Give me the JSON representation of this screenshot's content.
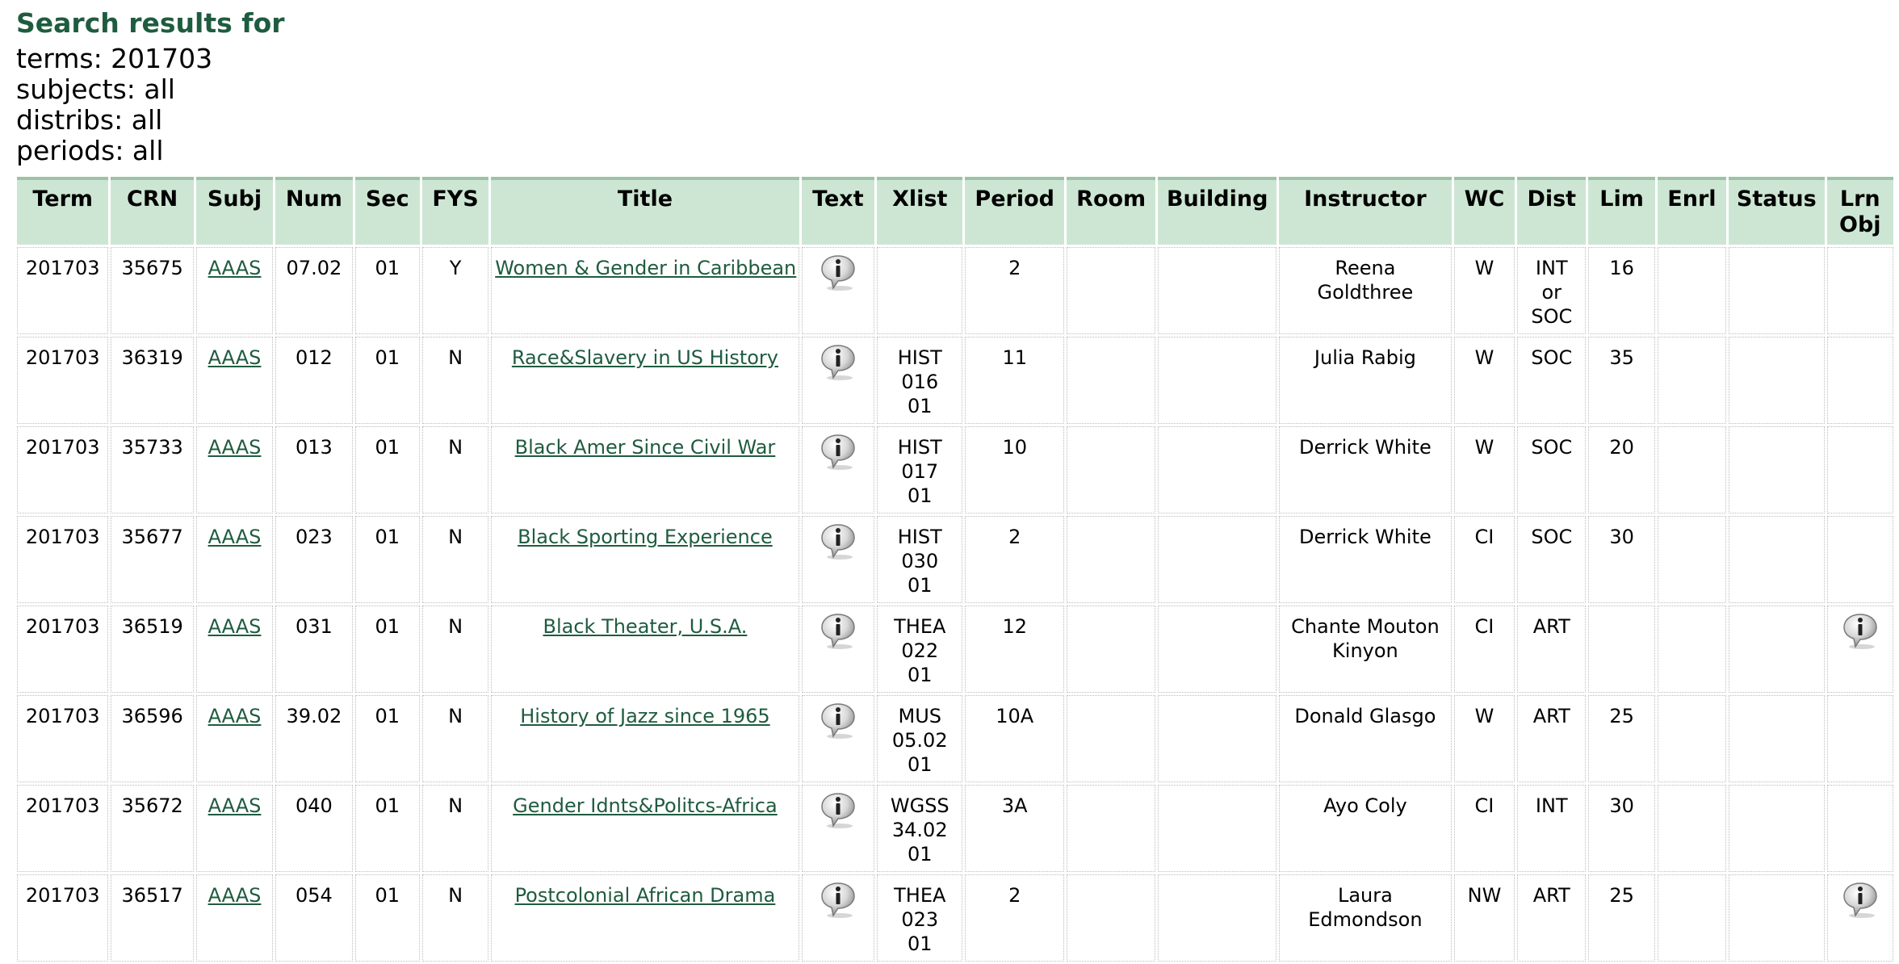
{
  "header": {
    "title": "Search results for",
    "criteria": [
      "terms: 201703",
      "subjects: all",
      "distribs: all",
      "periods: all"
    ]
  },
  "table": {
    "columns": [
      "Term",
      "CRN",
      "Subj",
      "Num",
      "Sec",
      "FYS",
      "Title",
      "Text",
      "Xlist",
      "Period",
      "Room",
      "Building",
      "Instructor",
      "WC",
      "Dist",
      "Lim",
      "Enrl",
      "Status",
      "Lrn Obj"
    ],
    "rows": [
      {
        "term": "201703",
        "crn": "35675",
        "subj": "AAAS",
        "num": "07.02",
        "sec": "01",
        "fys": "Y",
        "title": "Women & Gender in Caribbean",
        "text": true,
        "xlist": [],
        "period": "2",
        "room": "",
        "building": "",
        "instructor": [
          "Reena",
          "Goldthree"
        ],
        "wc": "W",
        "dist": [
          "INT",
          "or",
          "SOC"
        ],
        "lim": "16",
        "enrl": "",
        "status": "",
        "lrn": false
      },
      {
        "term": "201703",
        "crn": "36319",
        "subj": "AAAS",
        "num": "012",
        "sec": "01",
        "fys": "N",
        "title": "Race&Slavery in US History",
        "text": true,
        "xlist": [
          "HIST",
          "016",
          "01"
        ],
        "period": "11",
        "room": "",
        "building": "",
        "instructor": [
          "Julia Rabig"
        ],
        "wc": "W",
        "dist": [
          "SOC"
        ],
        "lim": "35",
        "enrl": "",
        "status": "",
        "lrn": false
      },
      {
        "term": "201703",
        "crn": "35733",
        "subj": "AAAS",
        "num": "013",
        "sec": "01",
        "fys": "N",
        "title": "Black Amer Since Civil War",
        "text": true,
        "xlist": [
          "HIST",
          "017",
          "01"
        ],
        "period": "10",
        "room": "",
        "building": "",
        "instructor": [
          "Derrick White"
        ],
        "wc": "W",
        "dist": [
          "SOC"
        ],
        "lim": "20",
        "enrl": "",
        "status": "",
        "lrn": false
      },
      {
        "term": "201703",
        "crn": "35677",
        "subj": "AAAS",
        "num": "023",
        "sec": "01",
        "fys": "N",
        "title": "Black Sporting Experience",
        "text": true,
        "xlist": [
          "HIST",
          "030",
          "01"
        ],
        "period": "2",
        "room": "",
        "building": "",
        "instructor": [
          "Derrick White"
        ],
        "wc": "CI",
        "dist": [
          "SOC"
        ],
        "lim": "30",
        "enrl": "",
        "status": "",
        "lrn": false
      },
      {
        "term": "201703",
        "crn": "36519",
        "subj": "AAAS",
        "num": "031",
        "sec": "01",
        "fys": "N",
        "title": "Black Theater, U.S.A.",
        "text": true,
        "xlist": [
          "THEA",
          "022",
          "01"
        ],
        "period": "12",
        "room": "",
        "building": "",
        "instructor": [
          "Chante Mouton",
          "Kinyon"
        ],
        "wc": "CI",
        "dist": [
          "ART"
        ],
        "lim": "",
        "enrl": "",
        "status": "",
        "lrn": true
      },
      {
        "term": "201703",
        "crn": "36596",
        "subj": "AAAS",
        "num": "39.02",
        "sec": "01",
        "fys": "N",
        "title": "History of Jazz since 1965",
        "text": true,
        "xlist": [
          "MUS",
          "05.02",
          "01"
        ],
        "period": "10A",
        "room": "",
        "building": "",
        "instructor": [
          "Donald Glasgo"
        ],
        "wc": "W",
        "dist": [
          "ART"
        ],
        "lim": "25",
        "enrl": "",
        "status": "",
        "lrn": false
      },
      {
        "term": "201703",
        "crn": "35672",
        "subj": "AAAS",
        "num": "040",
        "sec": "01",
        "fys": "N",
        "title": "Gender Idnts&Politcs-Africa",
        "text": true,
        "xlist": [
          "WGSS",
          "34.02",
          "01"
        ],
        "period": "3A",
        "room": "",
        "building": "",
        "instructor": [
          "Ayo Coly"
        ],
        "wc": "CI",
        "dist": [
          "INT"
        ],
        "lim": "30",
        "enrl": "",
        "status": "",
        "lrn": false
      },
      {
        "term": "201703",
        "crn": "36517",
        "subj": "AAAS",
        "num": "054",
        "sec": "01",
        "fys": "N",
        "title": "Postcolonial African Drama",
        "text": true,
        "xlist": [
          "THEA",
          "023",
          "01"
        ],
        "period": "2",
        "room": "",
        "building": "",
        "instructor": [
          "Laura",
          "Edmondson"
        ],
        "wc": "NW",
        "dist": [
          "ART"
        ],
        "lim": "25",
        "enrl": "",
        "status": "",
        "lrn": true
      }
    ]
  },
  "icons": {
    "info": "info-speech-bubble-icon"
  },
  "colors": {
    "heading": "#1f5c3f",
    "header_bg": "#cde6d3",
    "link": "#1f5c3f"
  }
}
